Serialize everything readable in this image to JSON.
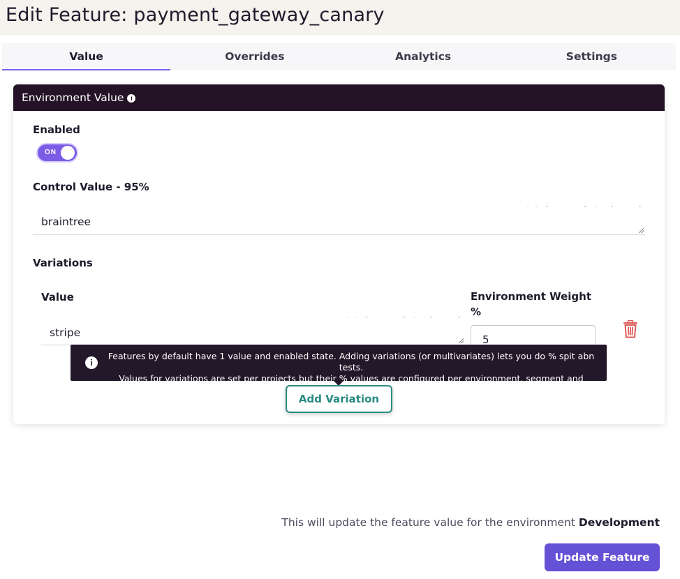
{
  "page": {
    "title": "Edit Feature: payment_gateway_canary"
  },
  "tabs": [
    {
      "label": "Value",
      "active": true
    },
    {
      "label": "Overrides"
    },
    {
      "label": "Analytics"
    },
    {
      "label": "Settings"
    }
  ],
  "card": {
    "header": "Environment Value",
    "info_icon": "i",
    "enabled_label": "Enabled",
    "toggle_label": "ON",
    "toggle_state": true,
    "control_label": "Control Value - 95%",
    "control_value": "braintree",
    "formats": [
      ".txt",
      ".json",
      ".xml",
      ".toml",
      ".yaml"
    ],
    "selected_format": ".txt",
    "variations_label": "Variations",
    "variation": {
      "value_label": "Value",
      "value": "stripe",
      "weight_label_line1": "Environment Weight",
      "weight_label_line2": "%",
      "weight": "5"
    }
  },
  "tooltip": {
    "icon": "i",
    "line1": "Features by default have 1 value and enabled state. Adding variations (or multivariates) lets you do % spit abn tests.",
    "line2": "Values for variations are set per projects but their % values are configured per environment, segment and identity."
  },
  "add_variation_button": "Add Variation",
  "footer": {
    "note_prefix": "This will update the feature value for the environment",
    "environment": "Development",
    "update_button": "Update Feature"
  },
  "colors": {
    "accent": "#7b5ce6",
    "card_header": "#241326",
    "format_selected": "#e8716b",
    "delete": "#e05b5b",
    "add_button": "#2a8b82",
    "update_button": "#6551d6"
  },
  "icons": {
    "delete": "trash-icon",
    "info": "info-icon",
    "resize": "resize-grip-icon"
  }
}
